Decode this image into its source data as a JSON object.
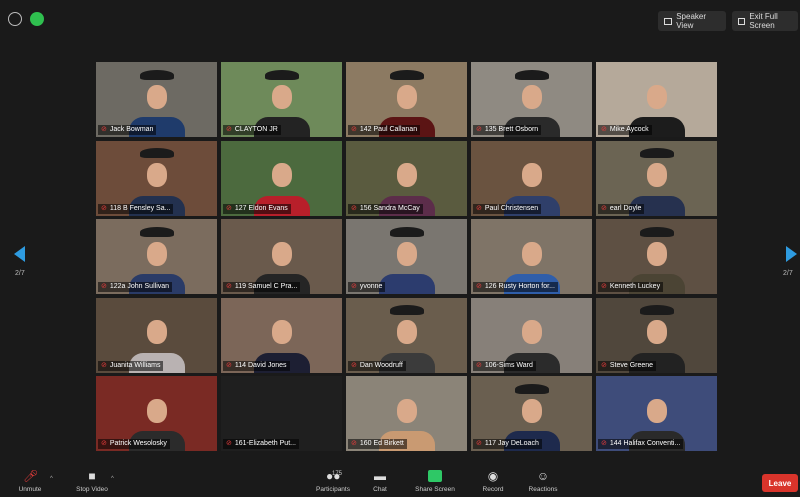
{
  "toolbar_top": {
    "speaker_view": "Speaker View",
    "exit_full_screen": "Exit Full Screen"
  },
  "pagination": {
    "left": "2/7",
    "right": "2/7"
  },
  "tiles": [
    {
      "name": "Jack Bowman",
      "bg": "#6d6a63",
      "body": "#1f3b6b",
      "hat": true
    },
    {
      "name": "CLAYTON JR",
      "bg": "#6e8a5a",
      "body": "#232323",
      "hat": true
    },
    {
      "name": "142 Paul Callanan",
      "bg": "#8c7a62",
      "body": "#5b1414",
      "hat": true
    },
    {
      "name": "135 Brett Osborn",
      "bg": "#8f8a82",
      "body": "#2a2a2a",
      "hat": true
    },
    {
      "name": "Mike Aycock",
      "bg": "#b5a99a",
      "body": "#1c1c1c",
      "hat": false
    },
    {
      "name": "118 B Fensley Sa...",
      "bg": "#6d4c3a",
      "body": "#23314f",
      "hat": true
    },
    {
      "name": "127 Eldon Evans",
      "bg": "#4c6a3e",
      "body": "#b81f2a",
      "hat": false
    },
    {
      "name": "156 Sandra McCay",
      "bg": "#5a5b3f",
      "body": "#5c2d4a",
      "hat": false
    },
    {
      "name": "Paul Christensen",
      "bg": "#6a5340",
      "body": "#2f3f6a",
      "hat": false
    },
    {
      "name": "earl Doyle",
      "bg": "#6b6453",
      "body": "#26314f",
      "hat": true
    },
    {
      "name": "122a John Sullivan",
      "bg": "#7b6c5e",
      "body": "#2a3b67",
      "hat": true
    },
    {
      "name": "119 Samuel C Pra...",
      "bg": "#6a5a4c",
      "body": "#252525",
      "hat": false
    },
    {
      "name": "yvonne",
      "bg": "#7a7670",
      "body": "#2c3c6e",
      "hat": true
    },
    {
      "name": "126 Rusty Horton for...",
      "bg": "#7f7467",
      "body": "#2f5eaa",
      "hat": false
    },
    {
      "name": "Kenneth Luckey",
      "bg": "#5e5043",
      "body": "#4b4434",
      "hat": true
    },
    {
      "name": "Juanita Williams",
      "bg": "#5a4b3d",
      "body": "#b9b2b2",
      "hat": false
    },
    {
      "name": "114 David Jones",
      "bg": "#7c6658",
      "body": "#1d1f33",
      "hat": false
    },
    {
      "name": "Dan Woodruff",
      "bg": "#6a5d4d",
      "body": "#3b3b3b",
      "hat": true
    },
    {
      "name": "106-Sims Ward",
      "bg": "#878079",
      "body": "#2b2b2b",
      "hat": false
    },
    {
      "name": "Steve Greene",
      "bg": "#50473c",
      "body": "#222222",
      "hat": true
    },
    {
      "name": "Patrick Wesolosky",
      "bg": "#7a2a24",
      "body": "#2b2b2b",
      "hat": false
    },
    {
      "name": "161-Elizabeth Put...",
      "bg": "#1f1f1f",
      "body": "#1f1f1f",
      "hat": false,
      "empty": true
    },
    {
      "name": "160 Ed Birkett",
      "bg": "#8b8478",
      "body": "#c99a72",
      "hat": false
    },
    {
      "name": "117 Jay DeLoach",
      "bg": "#6a5f50",
      "body": "#1e2a4d",
      "hat": true
    },
    {
      "name": "144 Halifax Conventi...",
      "bg": "#3e4c7a",
      "body": "#2a2a2a",
      "hat": false
    }
  ],
  "bottombar": {
    "unmute": "Unmute",
    "stop_video": "Stop Video",
    "participants_count": "175",
    "participants": "Participants",
    "chat": "Chat",
    "share_screen": "Share Screen",
    "record": "Record",
    "reactions": "Reactions",
    "leave": "Leave"
  }
}
